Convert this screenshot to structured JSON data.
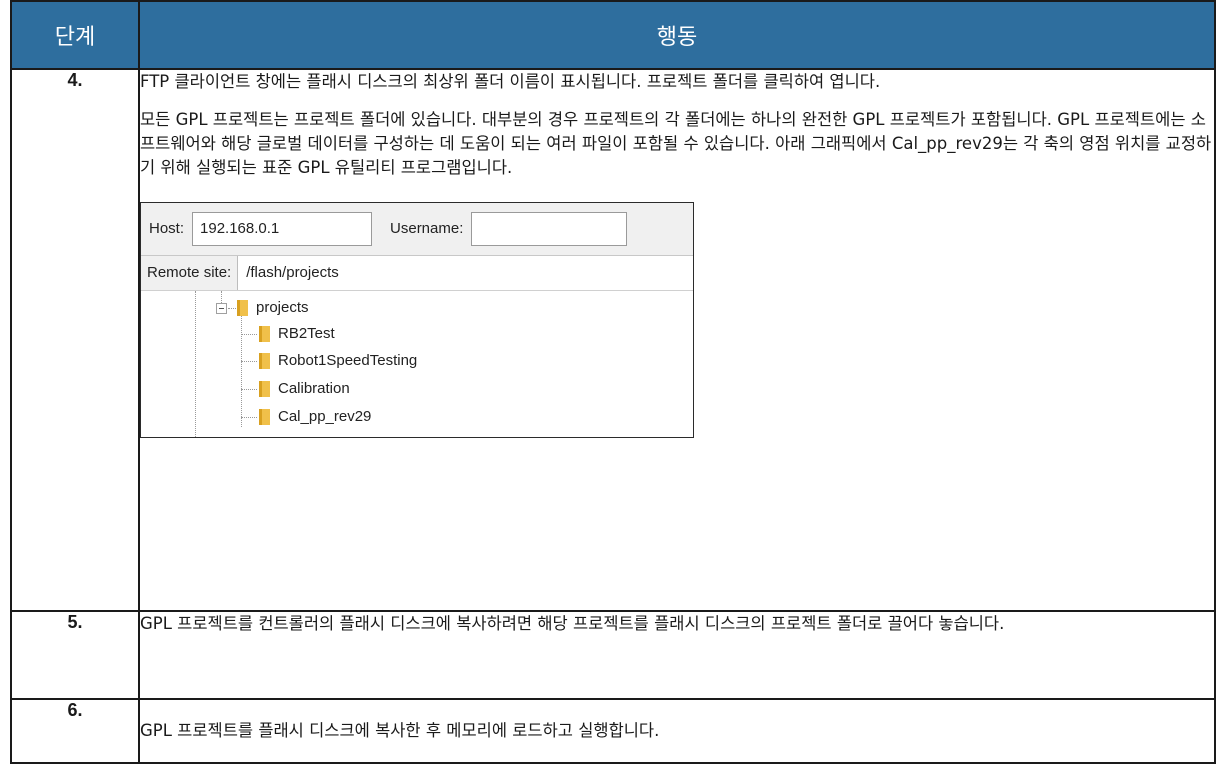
{
  "header": {
    "step": "단계",
    "action": "행동"
  },
  "steps": [
    {
      "number": "4.",
      "paragraphs": [
        "FTP 클라이언트 창에는 플래시 디스크의 최상위 폴더 이름이 표시됩니다. 프로젝트 폴더를 클릭하여 엽니다.",
        "모든 GPL 프로젝트는 프로젝트 폴더에 있습니다. 대부분의 경우 프로젝트의 각 폴더에는 하나의 완전한 GPL 프로젝트가 포함됩니다. GPL 프로젝트에는 소프트웨어와 해당 글로벌 데이터를 구성하는 데 도움이 되는 여러 파일이 포함될 수 있습니다. 아래 그래픽에서 Cal_pp_rev29는 각 축의 영점 위치를 교정하기 위해 실행되는 표준 GPL 유틸리티 프로그램입니다."
      ],
      "ftp": {
        "host_label": "Host:",
        "host_value": "192.168.0.1",
        "username_label": "Username:",
        "username_value": "",
        "remote_label": "Remote site:",
        "remote_path": "/flash/projects",
        "root_folder": "projects",
        "folders": [
          "RB2Test",
          "Robot1SpeedTesting",
          "Calibration",
          "Cal_pp_rev29"
        ]
      }
    },
    {
      "number": "5.",
      "text": "GPL 프로젝트를 컨트롤러의 플래시 디스크에 복사하려면 해당 프로젝트를 플래시 디스크의 프로젝트 폴더로 끌어다 놓습니다."
    },
    {
      "number": "6.",
      "text": "GPL 프로젝트를 플래시 디스크에 복사한 후 메모리에 로드하고 실행합니다."
    }
  ]
}
